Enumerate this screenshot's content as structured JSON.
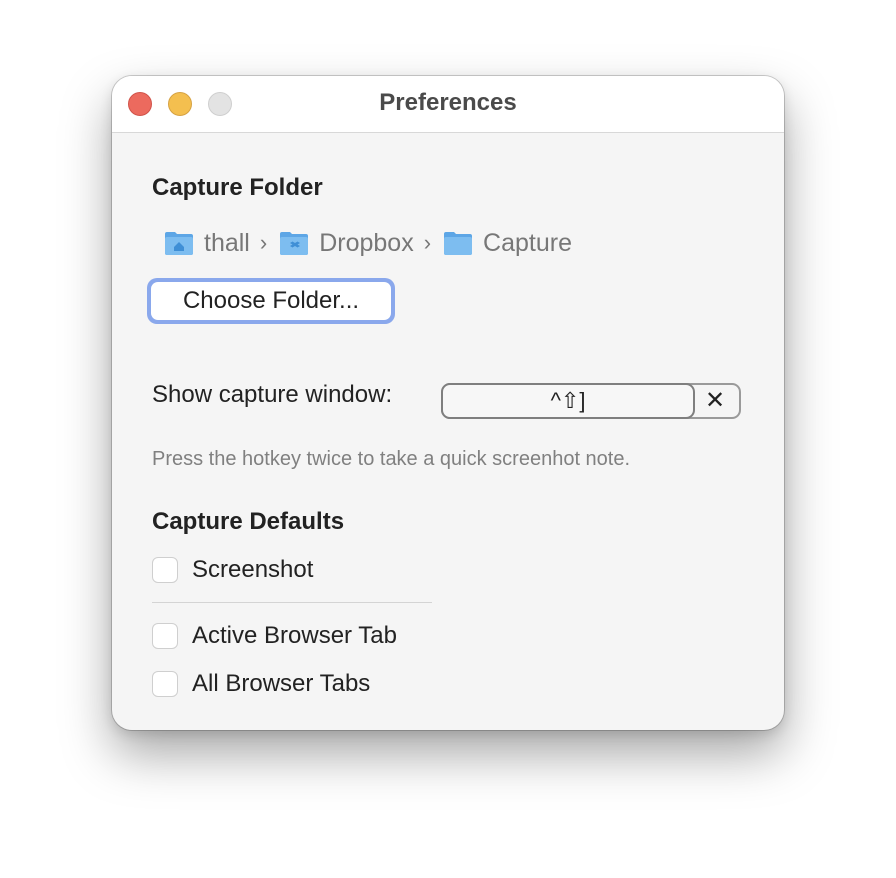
{
  "window": {
    "title": "Preferences",
    "traffic_lights": [
      "close",
      "minimize",
      "zoom"
    ]
  },
  "capture_folder": {
    "heading": "Capture Folder",
    "path": [
      {
        "name": "thall",
        "icon": "home-folder-icon"
      },
      {
        "name": "Dropbox",
        "icon": "dropbox-folder-icon"
      },
      {
        "name": "Capture",
        "icon": "folder-icon"
      }
    ],
    "separator": "›",
    "choose_button": "Choose Folder..."
  },
  "hotkey": {
    "label": "Show capture window:",
    "value": "^⇧]",
    "clear_label": "✕",
    "hint": "Press the hotkey twice to take a quick screenhot note."
  },
  "capture_defaults": {
    "heading": "Capture Defaults",
    "options": [
      {
        "label": "Screenshot",
        "checked": false
      },
      {
        "label": "Active Browser Tab",
        "checked": false
      },
      {
        "label": "All Browser Tabs",
        "checked": false
      }
    ]
  },
  "colors": {
    "focus_ring": "#8aa8ec",
    "close": "#ec6a5e",
    "minimize": "#f4bf4f",
    "folder": "#6fb3ec"
  }
}
